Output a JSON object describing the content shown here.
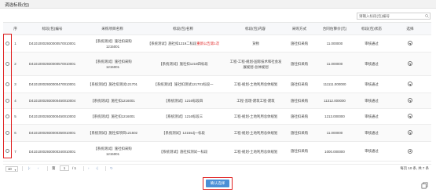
{
  "dialog": {
    "title": "调选标段(包)"
  },
  "search": {
    "placeholder": "请输入标段(包)编号"
  },
  "table": {
    "columns": [
      "",
      "序",
      "标段(包)编号",
      "采购项目名称",
      "标段(包)名称",
      "标段(包)内容",
      "采购方式",
      "合同估算价(元)",
      "标段(包)状态",
      "选择"
    ],
    "rows": [
      {
        "seq": "1",
        "code": "D41010002930000570010001",
        "project": "【系统测试】施社扣采购1215001",
        "name_prefix": "【系统测试】施社扣1219二标段",
        "name_red": "重新公告第1次",
        "content": "货物",
        "method": "施社扣采购",
        "price": "11.000000",
        "status": "审核通过"
      },
      {
        "seq": "2",
        "code": "D41010002930000570010001",
        "project": "【系统测试】施社扣采购1215001",
        "name_prefix": "【系统测试】施社扣1219四标段",
        "name_red": "",
        "content": "工程-工程-规划-国际技术和社会发展规划-总体规划",
        "method": "施社扣采购",
        "price": "11.000000",
        "status": "审核通过"
      },
      {
        "seq": "3",
        "code": "D41010002930000470010001",
        "project": "【系统测试】施社扣测试121701",
        "name_prefix": "【系统测试】施社扣测试121701标段一",
        "name_red": "",
        "content": "工程-规划-土地利用总体规划",
        "method": "施社扣采购",
        "price": "111111.000000",
        "status": "审核通过"
      },
      {
        "seq": "4",
        "code": "D41010002930000450010004",
        "project": "【系统测试】施社扣1216001",
        "name_prefix": "【系统测试】1216标段四",
        "name_red": "",
        "content": "工程-监理-建筑工程-建筑",
        "method": "施社扣采购",
        "price": "11312.000000",
        "status": "审核通过"
      },
      {
        "seq": "5",
        "code": "D41010002930000450010003",
        "project": "【系统测试】施社扣1216001",
        "name_prefix": "【系统测试】1216标段三",
        "name_red": "",
        "content": "工程-规划-土地利用总体规划",
        "method": "施社扣采购",
        "price": "1213.000000",
        "status": "审核通过"
      },
      {
        "seq": "6",
        "code": "D41010002930000350010001",
        "project": "【系统测试】施社扣项目121502",
        "name_prefix": "【系统测试】1215sdj一标段",
        "name_red": "",
        "content": "工程-规划-土地利用总体规划",
        "method": "施社扣采购",
        "price": "11.000000",
        "status": "审核通过"
      },
      {
        "seq": "7",
        "code": "D41010002930000340010001",
        "project": "【系统测试】施社扣采购1215001",
        "name_prefix": "【系统测试】施社扣测试一标段",
        "name_red": "",
        "content": "工程-规划-土地利用总体规划",
        "method": "施社扣采购",
        "price": "1000.000000",
        "status": "审核通过"
      }
    ]
  },
  "pagination": {
    "page_size": "10",
    "current_page": "1",
    "total_pages_text": "/ 1",
    "summary": "每页 10 条, 共 7 条"
  },
  "footer": {
    "confirm_label": "确认选择"
  },
  "colors": {
    "accent": "#4b8fd6",
    "highlight": "#e02020"
  }
}
